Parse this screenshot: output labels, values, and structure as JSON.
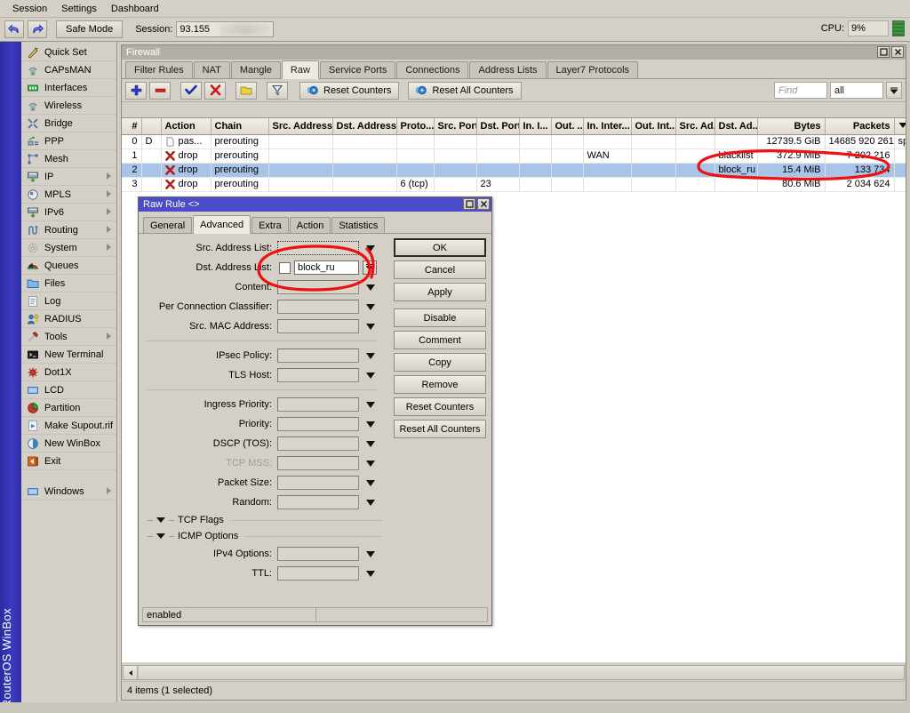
{
  "menubar": {
    "items": [
      "Session",
      "Settings",
      "Dashboard"
    ]
  },
  "toolbar": {
    "undo_icon": "undo-arrow-icon",
    "redo_icon": "redo-arrow-icon",
    "safe_mode_label": "Safe Mode",
    "session_label": "Session:",
    "session_value": "93.155",
    "cpu_label": "CPU:",
    "cpu_value": "9%"
  },
  "sidebar": {
    "brand": "RouterOS WinBox",
    "items": [
      {
        "label": "Quick Set",
        "icon": "wand-icon",
        "submenu": false
      },
      {
        "label": "CAPsMAN",
        "icon": "capsman-icon",
        "submenu": false
      },
      {
        "label": "Interfaces",
        "icon": "interfaces-icon",
        "submenu": false
      },
      {
        "label": "Wireless",
        "icon": "wireless-icon",
        "submenu": false
      },
      {
        "label": "Bridge",
        "icon": "bridge-icon",
        "submenu": false
      },
      {
        "label": "PPP",
        "icon": "ppp-icon",
        "submenu": false
      },
      {
        "label": "Mesh",
        "icon": "mesh-icon",
        "submenu": false
      },
      {
        "label": "IP",
        "icon": "ip-icon",
        "submenu": true
      },
      {
        "label": "MPLS",
        "icon": "mpls-icon",
        "submenu": true
      },
      {
        "label": "IPv6",
        "icon": "ipv6-icon",
        "submenu": true
      },
      {
        "label": "Routing",
        "icon": "routing-icon",
        "submenu": true
      },
      {
        "label": "System",
        "icon": "system-icon",
        "submenu": true
      },
      {
        "label": "Queues",
        "icon": "queues-icon",
        "submenu": false
      },
      {
        "label": "Files",
        "icon": "folder-icon",
        "submenu": false
      },
      {
        "label": "Log",
        "icon": "log-icon",
        "submenu": false
      },
      {
        "label": "RADIUS",
        "icon": "radius-icon",
        "submenu": false
      },
      {
        "label": "Tools",
        "icon": "tools-icon",
        "submenu": true
      },
      {
        "label": "New Terminal",
        "icon": "terminal-icon",
        "submenu": false
      },
      {
        "label": "Dot1X",
        "icon": "dot1x-icon",
        "submenu": false
      },
      {
        "label": "LCD",
        "icon": "lcd-icon",
        "submenu": false
      },
      {
        "label": "Partition",
        "icon": "partition-icon",
        "submenu": false
      },
      {
        "label": "Make Supout.rif",
        "icon": "supout-icon",
        "submenu": false
      },
      {
        "label": "New WinBox",
        "icon": "winbox-icon",
        "submenu": false
      },
      {
        "label": "Exit",
        "icon": "exit-icon",
        "submenu": false
      },
      {
        "label": "Windows",
        "icon": "windows-icon",
        "submenu": true
      }
    ]
  },
  "firewall": {
    "title": "Firewall",
    "tabs": [
      {
        "label": "Filter Rules",
        "active": false
      },
      {
        "label": "NAT",
        "active": false
      },
      {
        "label": "Mangle",
        "active": false
      },
      {
        "label": "Raw",
        "active": true
      },
      {
        "label": "Service Ports",
        "active": false
      },
      {
        "label": "Connections",
        "active": false
      },
      {
        "label": "Address Lists",
        "active": false
      },
      {
        "label": "Layer7 Protocols",
        "active": false
      }
    ],
    "toolbar": {
      "add_icon": "plus-icon",
      "remove_icon": "minus-icon",
      "enable_icon": "check-icon",
      "disable_icon": "cross-icon",
      "comment_icon": "comment-note-icon",
      "filter_icon": "funnel-filter-icon",
      "reset_counters_label": "Reset Counters",
      "reset_all_counters_label": "Reset All Counters",
      "reset_icon": "reset-counter-icon",
      "find_placeholder": "Find",
      "filter_scope_value": "all"
    },
    "columns": [
      "#",
      "",
      "Action",
      "Chain",
      "Src. Address",
      "Dst. Address",
      "Proto...",
      "Src. Port",
      "Dst. Port",
      "In. I...",
      "Out. ...",
      "In. Inter...",
      "Out. Int...",
      "Src. Ad...",
      "Dst. Ad...",
      "Bytes",
      "Packets",
      ""
    ],
    "rows": [
      {
        "num": "0",
        "flag": "D",
        "action": "pas...",
        "action_icon": "passthrough-icon",
        "chain": "prerouting",
        "src_address": "",
        "dst_address": "",
        "proto": "",
        "src_port": "",
        "dst_port": "",
        "in_i": "",
        "out_": "",
        "in_inter": "",
        "out_int": "",
        "src_ad": "",
        "dst_ad": "",
        "bytes": "12739.5 GiB",
        "packets": "14685 920 261",
        "extra": "spe",
        "selected": false
      },
      {
        "num": "1",
        "flag": "",
        "action": "drop",
        "action_icon": "drop-icon",
        "chain": "prerouting",
        "src_address": "",
        "dst_address": "",
        "proto": "",
        "src_port": "",
        "dst_port": "",
        "in_i": "",
        "out_": "",
        "in_inter": "WAN",
        "out_int": "",
        "src_ad": "",
        "dst_ad": "blacklist",
        "bytes": "372.9 MiB",
        "packets": "7 202 216",
        "extra": "",
        "selected": false
      },
      {
        "num": "2",
        "flag": "",
        "action": "drop",
        "action_icon": "drop-icon",
        "chain": "prerouting",
        "src_address": "",
        "dst_address": "",
        "proto": "",
        "src_port": "",
        "dst_port": "",
        "in_i": "",
        "out_": "",
        "in_inter": "",
        "out_int": "",
        "src_ad": "",
        "dst_ad": "block_ru",
        "bytes": "15.4 MiB",
        "packets": "133 734",
        "extra": "",
        "selected": true
      },
      {
        "num": "3",
        "flag": "",
        "action": "drop",
        "action_icon": "drop-icon",
        "chain": "prerouting",
        "src_address": "",
        "dst_address": "",
        "proto": "6 (tcp)",
        "src_port": "",
        "dst_port": "23",
        "in_i": "",
        "out_": "",
        "in_inter": "",
        "out_int": "",
        "src_ad": "",
        "dst_ad": "",
        "bytes": "80.6 MiB",
        "packets": "2 034 624",
        "extra": "",
        "selected": false
      }
    ],
    "status": "4 items (1 selected)"
  },
  "dialog": {
    "title": "Raw Rule <>",
    "tabs": [
      {
        "label": "General",
        "active": false
      },
      {
        "label": "Advanced",
        "active": true
      },
      {
        "label": "Extra",
        "active": false
      },
      {
        "label": "Action",
        "active": false
      },
      {
        "label": "Statistics",
        "active": false
      }
    ],
    "fields": [
      {
        "label": "Src. Address List:",
        "value": "",
        "type": "dotted",
        "dim": false
      },
      {
        "label": "Dst. Address List:",
        "value": "block_ru",
        "type": "checkvalue",
        "dim": false
      },
      {
        "label": "Content:",
        "value": "",
        "type": "plain",
        "dim": false
      },
      {
        "label": "Per Connection Classifier:",
        "value": "",
        "type": "plain",
        "dim": false
      },
      {
        "label": "Src. MAC Address:",
        "value": "",
        "type": "plain",
        "dim": false
      },
      {
        "label": "IPsec Policy:",
        "value": "",
        "type": "plain",
        "dim": false,
        "sep_before": true
      },
      {
        "label": "TLS Host:",
        "value": "",
        "type": "plain",
        "dim": false
      },
      {
        "label": "Ingress Priority:",
        "value": "",
        "type": "plain",
        "dim": false,
        "sep_before": true
      },
      {
        "label": "Priority:",
        "value": "",
        "type": "plain",
        "dim": false
      },
      {
        "label": "DSCP (TOS):",
        "value": "",
        "type": "plain",
        "dim": false
      },
      {
        "label": "TCP MSS:",
        "value": "",
        "type": "plain",
        "dim": true
      },
      {
        "label": "Packet Size:",
        "value": "",
        "type": "plain",
        "dim": false
      },
      {
        "label": "Random:",
        "value": "",
        "type": "plain",
        "dim": false
      }
    ],
    "groups": [
      {
        "label": "TCP Flags"
      },
      {
        "label": "ICMP Options"
      }
    ],
    "fields2": [
      {
        "label": "IPv4 Options:",
        "value": "",
        "type": "plain",
        "dim": false
      },
      {
        "label": "TTL:",
        "value": "",
        "type": "plain",
        "dim": false
      }
    ],
    "buttons": [
      {
        "label": "OK",
        "primary": true,
        "spaced": false
      },
      {
        "label": "Cancel",
        "primary": false,
        "spaced": false
      },
      {
        "label": "Apply",
        "primary": false,
        "spaced": false
      },
      {
        "label": "Disable",
        "primary": false,
        "spaced": true
      },
      {
        "label": "Comment",
        "primary": false,
        "spaced": false
      },
      {
        "label": "Copy",
        "primary": false,
        "spaced": false
      },
      {
        "label": "Remove",
        "primary": false,
        "spaced": false
      },
      {
        "label": "Reset Counters",
        "primary": false,
        "spaced": false
      },
      {
        "label": "Reset All Counters",
        "primary": false,
        "spaced": false
      }
    ],
    "status": "enabled"
  },
  "annotations": {
    "color": "#ee1111",
    "marks": [
      "ellipse-around-block-ru-row-counters",
      "ellipse-around-dst-address-list-field"
    ]
  }
}
